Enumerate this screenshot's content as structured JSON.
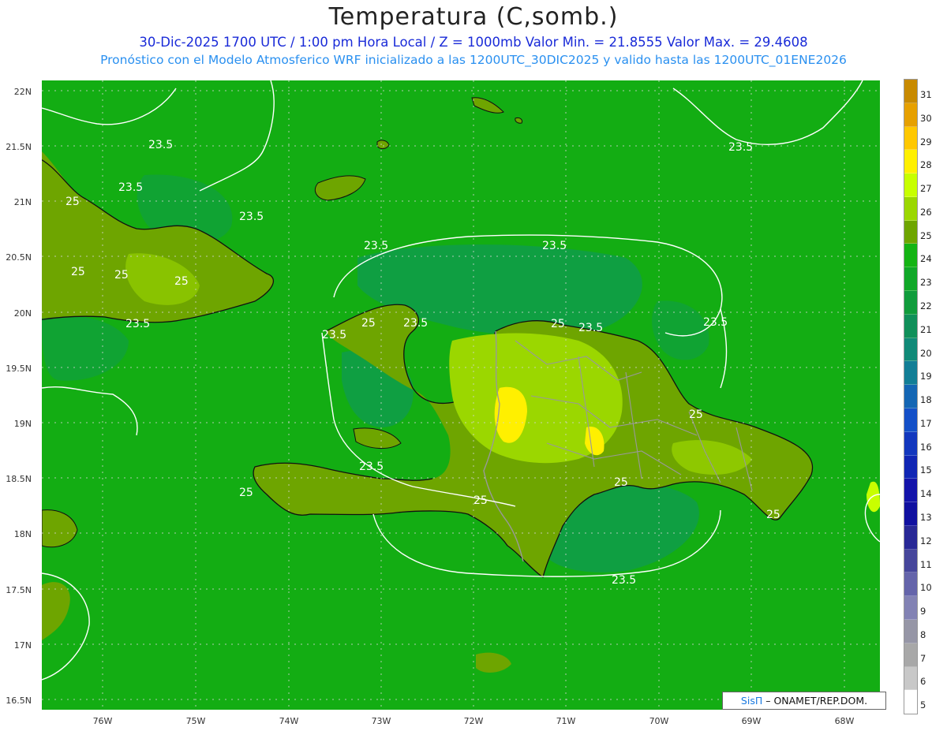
{
  "header": {
    "title": "Temperatura (C,somb.)",
    "subtitle": "30-Dic-2025  1700 UTC / 1:00 pm Hora Local / Z = 1000mb   Valor Min. = 21.8555  Valor Max. = 29.4608",
    "subtitle2": "Pronóstico con el Modelo Atmosferico WRF inicializado a las 1200UTC_30DIC2025 y valido hasta las  1200UTC_01ENE2026"
  },
  "map": {
    "lat_labels": [
      "22N",
      "21.5N",
      "21N",
      "20.5N",
      "20N",
      "19.5N",
      "19N",
      "18.5N",
      "18N",
      "17.5N",
      "17N",
      "16.5N"
    ],
    "lon_labels": [
      "76W",
      "75W",
      "74W",
      "73W",
      "72W",
      "71W",
      "70W",
      "69W",
      "68W"
    ],
    "contour_labels": [
      "23.5",
      "23.5",
      "23.5",
      "23.5",
      "23.5",
      "23.5",
      "23.5",
      "23.5",
      "23.5",
      "23.5",
      "23.5",
      "23.5",
      "23.5",
      "25",
      "25",
      "25",
      "25",
      "25",
      "25",
      "25",
      "25",
      "25",
      "25",
      "25"
    ]
  },
  "colorbar": {
    "labels": [
      "31",
      "30",
      "29",
      "28",
      "27",
      "26",
      "25",
      "24",
      "23",
      "22",
      "21",
      "20",
      "19",
      "18",
      "17",
      "16",
      "15",
      "14",
      "13",
      "12",
      "11",
      "10",
      "9",
      "8",
      "7",
      "6",
      "5"
    ],
    "colors": [
      "#c88a00",
      "#e6a000",
      "#ffc800",
      "#fff000",
      "#c8ff00",
      "#9bd700",
      "#6ea500",
      "#14b414",
      "#10a828",
      "#109c3c",
      "#10905a",
      "#108a78",
      "#127e96",
      "#1466b4",
      "#1450c8",
      "#1237be",
      "#1026b4",
      "#1414aa",
      "#1010a0",
      "#282896",
      "#46469b",
      "#6464aa",
      "#8282b4",
      "#9696a6",
      "#a8a8a8",
      "#c8c8c8",
      "#ffffff"
    ]
  },
  "credit": {
    "brand": "SisΠ",
    "text": "– ONAMET/REP.DOM."
  }
}
